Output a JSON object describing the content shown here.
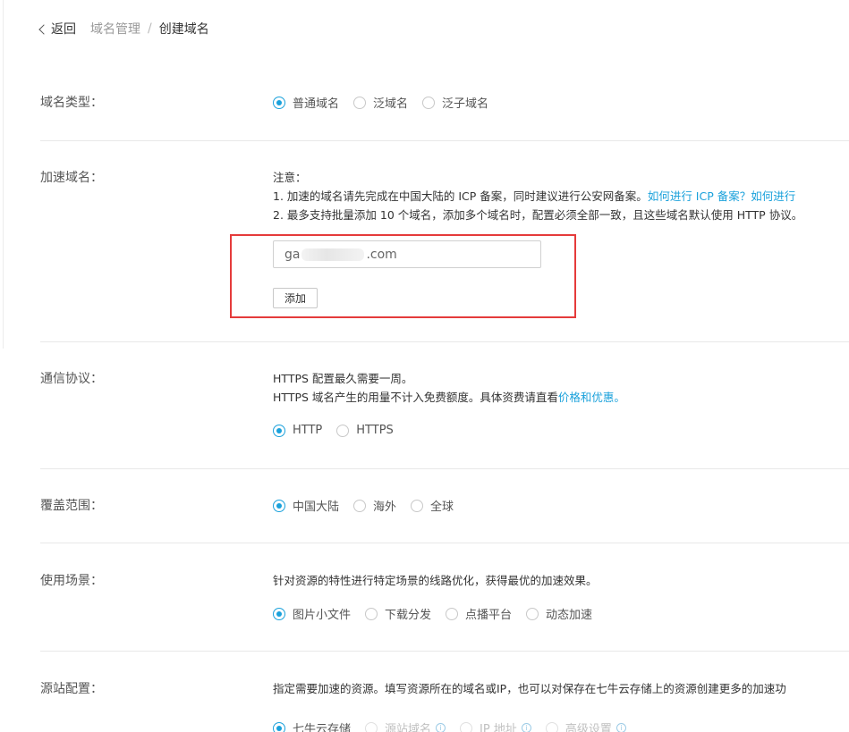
{
  "breadcrumb": {
    "back": "返回",
    "parent": "域名管理",
    "separator": "/",
    "current": "创建域名"
  },
  "domain_type": {
    "label": "域名类型：",
    "options": [
      "普通域名",
      "泛域名",
      "泛子域名"
    ],
    "selected": "普通域名"
  },
  "accel_domain": {
    "label": "加速域名：",
    "note_title": "注意：",
    "note_1": "1. 加速的域名请先完成在中国大陆的 ICP 备案，同时建议进行公安网备案。",
    "note_1_link": "如何进行 ICP 备案？如何进行",
    "note_2": "2. 最多支持批量添加 10 个域名，添加多个域名时，配置必须全部一致，且这些域名默认使用 HTTP 协议。",
    "input_prefix": "ga",
    "input_suffix": ".com",
    "add_button": "添加"
  },
  "protocol": {
    "label": "通信协议：",
    "line_1": "HTTPS 配置最久需要一周。",
    "line_2": "HTTPS 域名产生的用量不计入免费额度。具体资费请直看",
    "line_2_link": "价格和优惠。",
    "options": [
      "HTTP",
      "HTTPS"
    ],
    "selected": "HTTP"
  },
  "coverage": {
    "label": "覆盖范围：",
    "options": [
      "中国大陆",
      "海外",
      "全球"
    ],
    "selected": "中国大陆"
  },
  "scenario": {
    "label": "使用场景：",
    "desc": "针对资源的特性进行特定场景的线路优化，获得最优的加速效果。",
    "options": [
      "图片小文件",
      "下载分发",
      "点播平台",
      "动态加速"
    ],
    "selected": "图片小文件"
  },
  "origin": {
    "label": "源站配置：",
    "desc": "指定需要加速的资源。填写资源所在的域名或IP，也可以对保存在七牛云存储上的资源创建更多的加速功",
    "options": [
      "七牛云存储",
      "源站域名",
      "IP 地址",
      "高级设置"
    ],
    "selected": "七牛云存储"
  },
  "colors": {
    "accent": "#1aa1db",
    "highlight": "#e53b3b"
  }
}
